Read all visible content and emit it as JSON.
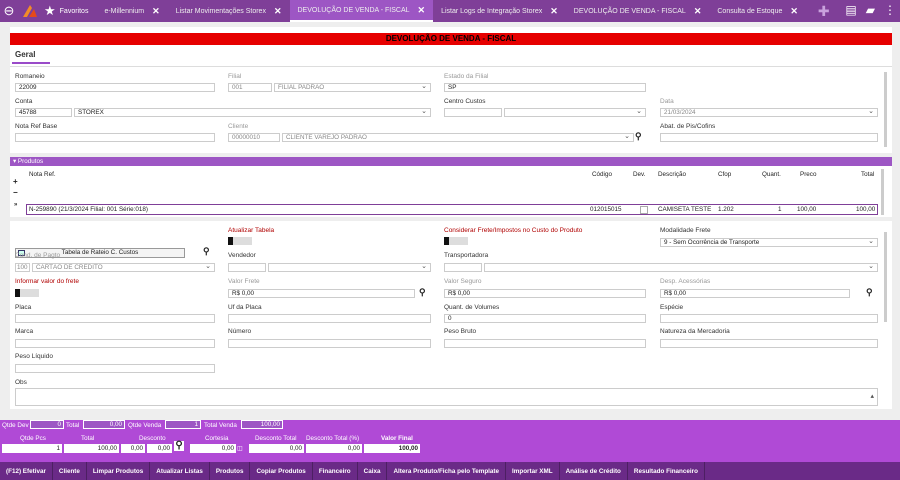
{
  "topbar": {
    "favorites": "Favoritos",
    "tabs": [
      {
        "label": "e-Millennium"
      },
      {
        "label": "Listar Movimentações Storex"
      },
      {
        "label": "DEVOLUÇÃO DE VENDA - FISCAL"
      },
      {
        "label": "Listar Logs de Integração Storex"
      },
      {
        "label": "DEVOLUÇÃO DE VENDA - FISCAL"
      },
      {
        "label": "Consulta de Estoque"
      }
    ],
    "active_tab": 2
  },
  "form": {
    "banner": "DEVOLUÇÃO DE VENDA - FISCAL",
    "section": "Geral",
    "romaneio": {
      "label": "Romaneio",
      "value": "22009"
    },
    "filial": {
      "label": "Filial",
      "code": "001",
      "name": "FILIAL PADRÃO"
    },
    "estado": {
      "label": "Estado da Filial",
      "value": "SP"
    },
    "conta": {
      "label": "Conta",
      "code": "45788",
      "name": "STOREX"
    },
    "centro": {
      "label": "Centro Custos"
    },
    "data": {
      "label": "Data",
      "value": "21/03/2024"
    },
    "nota_ref": {
      "label": "Nota Ref Base"
    },
    "cliente": {
      "label": "Cliente",
      "code": "00000010",
      "name": "CLIENTE VAREJO PADRÃO"
    },
    "abat": {
      "label": "Abat. de Pis/Cofins"
    }
  },
  "produtos": {
    "header": "Produtos",
    "columns": {
      "nota": "Nota Ref.",
      "codigo": "Código",
      "dev": "Dev.",
      "descricao": "Descrição",
      "cfop": "Cfop",
      "quant": "Quant.",
      "preco": "Preco",
      "total": "Total"
    },
    "rows": [
      {
        "nota": "N-259890 (21/3/2024 Filial: 001 Série:018)",
        "codigo": "012015015",
        "dev": "",
        "descricao": "CAMISETA TESTE",
        "cfop": "1.202",
        "quant": "1",
        "preco": "100,00",
        "total": "100,00"
      }
    ]
  },
  "details": {
    "rateio_btn": "Tabela de Rateio C. Custos",
    "atualizar": "Atualizar Tabela",
    "considerar": "Considerar Frete/Impostos no Custo do Produto",
    "modalidade": {
      "label": "Modalidade Frete",
      "value": "9 - Sem Ocorrência de Transporte"
    },
    "cond": {
      "label": "Cond. de Pagto",
      "code": "100",
      "name": "CARTÃO DE CREDITO"
    },
    "vendedor": "Vendedor",
    "transportadora": "Transportadora",
    "informar": "Informar valor do frete",
    "valor_frete": {
      "label": "Valor Frete",
      "value": "R$ 0,00"
    },
    "valor_seguro": {
      "label": "Valor Seguro",
      "value": "R$ 0,00"
    },
    "desp": {
      "label": "Desp. Acessórias",
      "value": "R$ 0,00"
    },
    "placa": "Placa",
    "uf_placa": "Uf da Placa",
    "quant_vol": {
      "label": "Quant. de Volumes",
      "value": "0"
    },
    "especie": "Espécie",
    "marca": "Marca",
    "numero": "Número",
    "peso_bruto": "Peso Bruto",
    "natureza": "Natureza da Mercadoria",
    "peso_liquido": "Peso Líquido",
    "obs": "Obs"
  },
  "totals": {
    "qtde_dev_label": "Qtde Dev",
    "qtde_dev": "0",
    "total_label": "Total",
    "total": "0,00",
    "qtde_venda_label": "Qtde Venda",
    "qtde_venda": "1",
    "total_venda_label": "Total Venda",
    "total_venda": "100,00",
    "qtde_pcs_label": "Qtde Pcs",
    "qtde_pcs": "1",
    "total2_label": "Total",
    "total2": "100,00",
    "desconto_label": "Desconto",
    "desc1": "0,00",
    "desc2": "0,00",
    "cortesia_label": "Cortesia",
    "cortesia": "0,00",
    "desc_total_label": "Desconto Total",
    "desc_total": "0,00",
    "desc_total_pct_label": "Desconto Total (%)",
    "desc_total_pct": "0,00",
    "valor_final_label": "Valor Final",
    "valor_final": "100,00"
  },
  "actions": [
    "(F12) Efetivar",
    "Cliente",
    "Limpar Produtos",
    "Atualizar Listas",
    "Produtos",
    "Copiar Produtos",
    "Financeiro",
    "Caixa",
    "Altera Produto/Ficha pelo Template",
    "Importar XML",
    "Análise de Crédito",
    "Resultado Financeiro"
  ]
}
